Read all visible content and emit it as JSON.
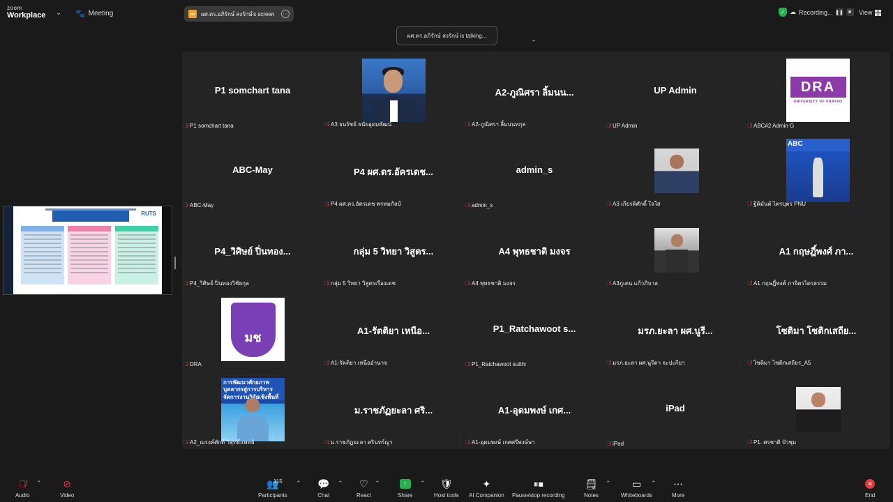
{
  "app": {
    "logo_top": "zoom",
    "logo_bottom": "Workplace",
    "meeting_label": "Meeting"
  },
  "share_pill": {
    "badge": "ผศ",
    "label": "ผศ.ดร.อภิรักษ์ สงรักษ์'s screen"
  },
  "recording": {
    "label": "Recording..."
  },
  "view_label": "View",
  "talking": "ผศ.ดร.อภิรักษ์ สงรักษ์ is talking...",
  "shared_screen": {
    "brand": "RUTS"
  },
  "tiles": [
    {
      "big": "P1 somchart tana",
      "name": "P1 somchart tana"
    },
    {
      "big": "",
      "name": "A3 ธนรัชย์ ธนัยอุดมพัฒน์"
    },
    {
      "big": "A2-ภูณิศรา ลิ้มนน...",
      "name": "A2-ภูณิศรา ลิ้มนนทกุล"
    },
    {
      "big": "UP Admin",
      "name": "UP Admin"
    },
    {
      "big": "",
      "name": "ABC#2 Admin G"
    },
    {
      "big": "ABC-May",
      "name": "ABC-May"
    },
    {
      "big": "P4 ผศ.ดร.อัครเดช...",
      "name": "P4 ผศ.ดร.อัครเดช พรหมกัลป์"
    },
    {
      "big": "admin_s",
      "name": "admin_s"
    },
    {
      "big": "",
      "name": "A3 เกียรติศักดิ์ ใจใส"
    },
    {
      "big": "",
      "name": "ฐิติมันต์ ไตรบุตร PNU"
    },
    {
      "big": "P4_วิศิษย์ ปิ่นทอง...",
      "name": "P4_วิศิษย์ ปิ่นทองวิชัยกุล"
    },
    {
      "big": "กลุ่ม 5 วิทยา วิสูตร...",
      "name": "กลุ่ม 5 วิทยา วิสูตรเรืองเดช"
    },
    {
      "big": "A4 พุทธชาติ มงจร",
      "name": "A4 พุทธชาติ มงจร"
    },
    {
      "big": "",
      "name": "A3ภูเดน แก้วภิบาล"
    },
    {
      "big": "A1 กฤษฎิ์พงศ์ ภา...",
      "name": "A1 กฤษฎิ์พงศ์ ภาจิตรไตรธรรม"
    },
    {
      "big": "",
      "name": "DRA"
    },
    {
      "big": "A1-รัตติยา เหนือ...",
      "name": "A1-รัตติยา เหนืออำนาจ"
    },
    {
      "big": "P1_Ratchawoot s...",
      "name": "P1_Ratchawoot sutthi"
    },
    {
      "big": "มรภ.ยะลา ผศ.นูรี...",
      "name": "มรภ.ยะลา ผศ.นูรีดา จะปะกียา"
    },
    {
      "big": "โซติมา โซติกเสถีย...",
      "name": "โซติมา โซติกเสถียร_A5"
    },
    {
      "big": "",
      "name": "A2_ณรงค์ศักดิ์ วิสุทธิ์แพทย์"
    },
    {
      "big": "ม.ราชภัฏยะลา ศริ...",
      "name": "ม.ราชภัฏยะลา ศรินทร์ญา"
    },
    {
      "big": "A1-อุดมพงษ์ เกศ...",
      "name": "A1-อุดมพงษ์ เกศศรีพงษ์ษา"
    },
    {
      "big": "iPad",
      "name": "iPad"
    },
    {
      "big": "",
      "name": "P1. ศรชาติ บัวชุม"
    }
  ],
  "photos": {
    "dra_logo_text": "DRA",
    "dra_caption": "UNIVERSITY OF PHAYAO",
    "blue_banner": "ABC",
    "univ_emblem": "มช",
    "speaker_banner": "การพัฒนาศักยภาพบุคลากรสู่การบริหารจัดการงานวิจัยเชิงพื้นที่"
  },
  "toolbar": {
    "audio": "Audio",
    "video": "Video",
    "participants": "Participants",
    "participants_count": "115",
    "chat": "Chat",
    "react": "React",
    "share": "Share",
    "host_tools": "Host tools",
    "ai_companion": "AI Companion",
    "pause_recording": "Pause/stop recording",
    "notes": "Notes",
    "whiteboards": "Whiteboards",
    "more": "More",
    "end": "End"
  },
  "colors": {
    "accent_green": "#23b14d",
    "danger_red": "#e03b3b",
    "gallery_bg": "#242424"
  }
}
